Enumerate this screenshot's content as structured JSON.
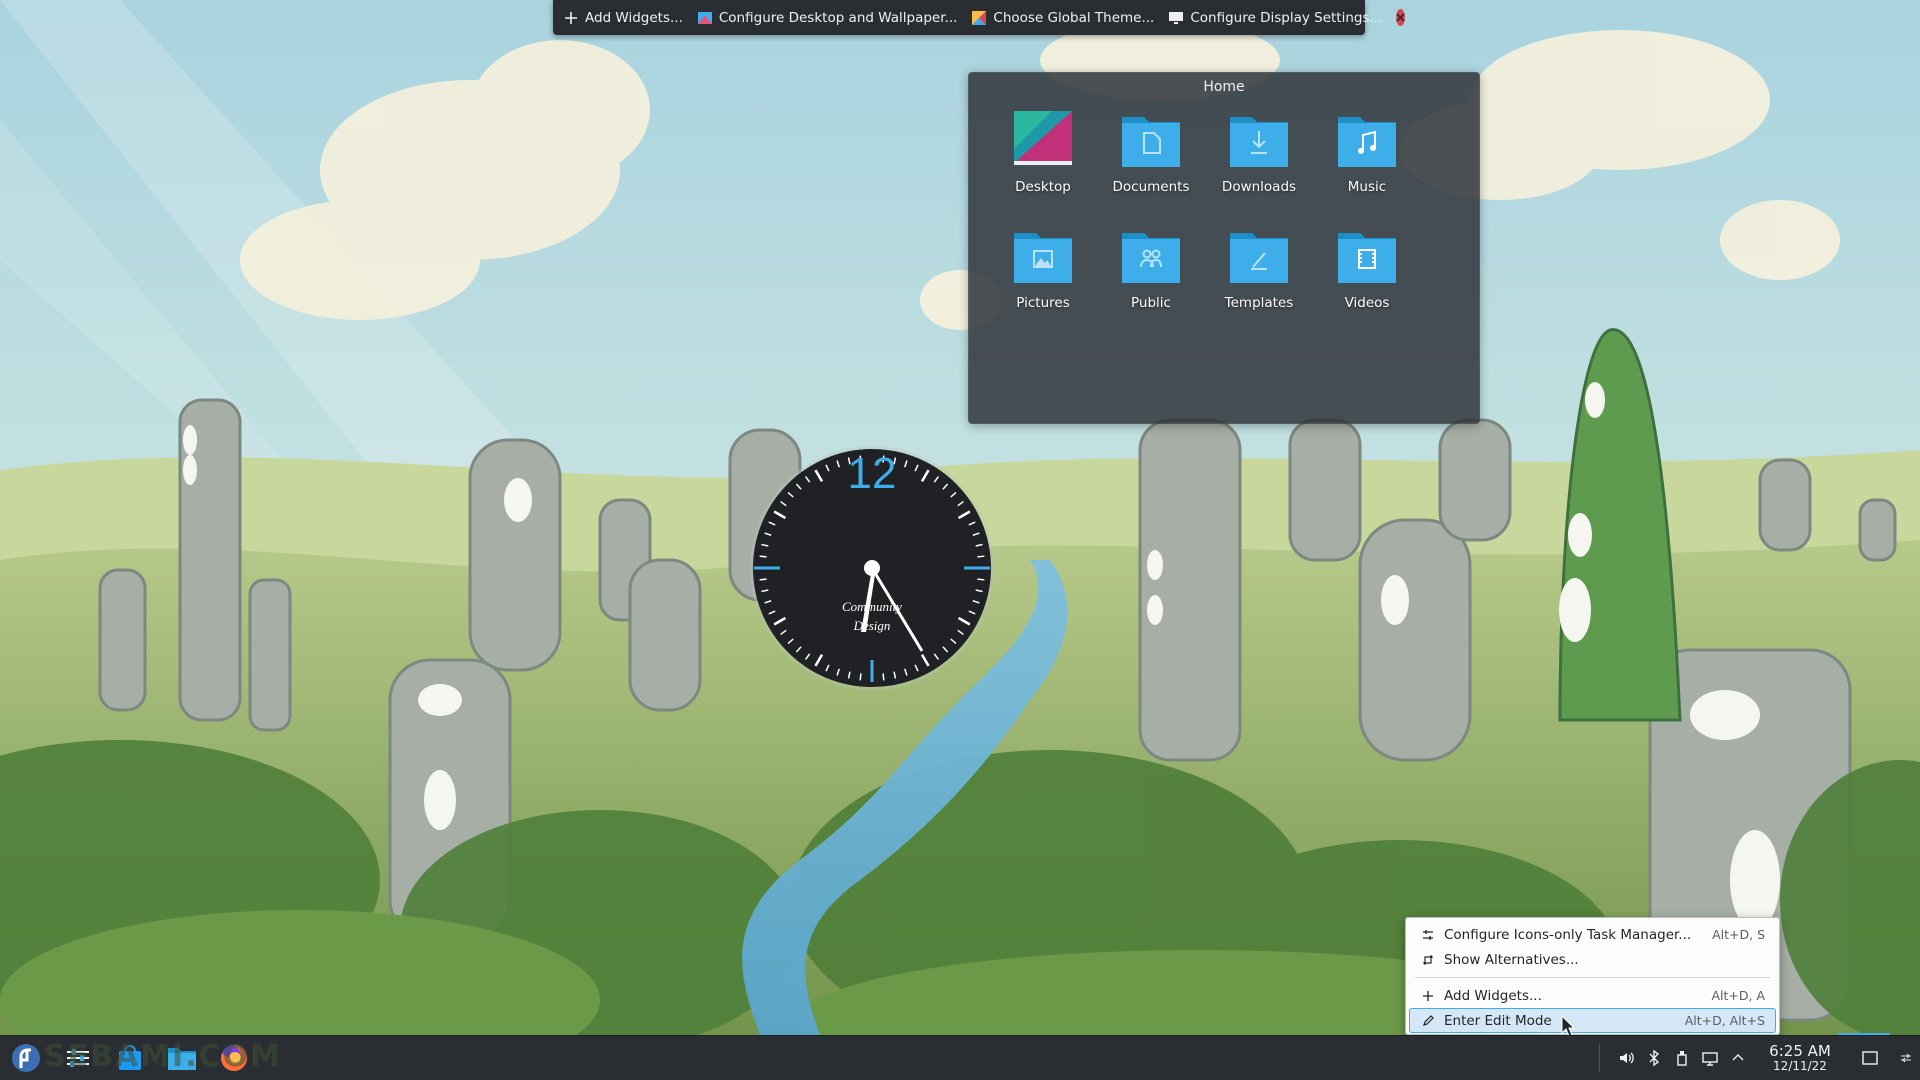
{
  "toolbar": {
    "add_widgets": "Add Widgets...",
    "configure_desktop": "Configure Desktop and Wallpaper...",
    "choose_theme": "Choose Global Theme...",
    "configure_display": "Configure Display Settings...",
    "close_icon": "close-icon"
  },
  "folder_view": {
    "title": "Home",
    "items": [
      {
        "label": "Desktop",
        "icon": "desktop-folder-icon"
      },
      {
        "label": "Documents",
        "icon": "documents-folder-icon"
      },
      {
        "label": "Downloads",
        "icon": "downloads-folder-icon"
      },
      {
        "label": "Music",
        "icon": "music-folder-icon"
      },
      {
        "label": "Pictures",
        "icon": "pictures-folder-icon"
      },
      {
        "label": "Public",
        "icon": "public-folder-icon"
      },
      {
        "label": "Templates",
        "icon": "templates-folder-icon"
      },
      {
        "label": "Videos",
        "icon": "videos-folder-icon"
      }
    ]
  },
  "analog_clock": {
    "numeral": "12",
    "brand_line1": "Community",
    "brand_line2": "Design"
  },
  "context_menu": {
    "items": [
      {
        "label": "Configure Icons-only Task Manager...",
        "shortcut": "Alt+D, S",
        "icon": "configure-icon"
      },
      {
        "label": "Show Alternatives...",
        "shortcut": "",
        "icon": "alternatives-icon"
      },
      {
        "label": "Add Widgets...",
        "shortcut": "Alt+D, A",
        "icon": "plus-icon"
      },
      {
        "label": "Enter Edit Mode",
        "shortcut": "Alt+D, Alt+S",
        "icon": "pencil-icon"
      }
    ]
  },
  "panel": {
    "watermark": "SEBAMI.COM",
    "clock_time": "6:25 AM",
    "clock_date": "12/11/22"
  },
  "colors": {
    "accent": "#3daee9",
    "panel": "#2a2e32",
    "close": "#da4453",
    "folder_blue": "#3daee9"
  }
}
